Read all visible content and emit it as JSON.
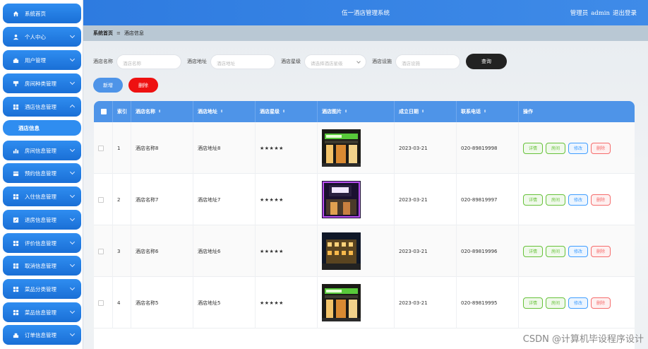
{
  "app": {
    "title": "伍一酒店管理系统",
    "user_role": "管理员",
    "user_name": "admin",
    "logout": "退出登录"
  },
  "breadcrumb": {
    "home": "系统首页",
    "sep": "≡",
    "current": "酒店信息"
  },
  "sidebar": {
    "items": [
      {
        "label": "系统首页",
        "icon": "home-icon",
        "expandable": false
      },
      {
        "label": "个人中心",
        "icon": "user-icon",
        "expandable": true
      },
      {
        "label": "用户管理",
        "icon": "users-icon",
        "expandable": true
      },
      {
        "label": "房间种类管理",
        "icon": "cup-icon",
        "expandable": true
      },
      {
        "label": "酒店信息管理",
        "icon": "grid-icon",
        "expandable": true,
        "expanded": true
      },
      {
        "label": "房间信息管理",
        "icon": "bar-chart-icon",
        "expandable": true
      },
      {
        "label": "预约信息管理",
        "icon": "calendar-icon",
        "expandable": true
      },
      {
        "label": "入住信息管理",
        "icon": "grid-icon",
        "expandable": true
      },
      {
        "label": "退房信息管理",
        "icon": "edit-icon",
        "expandable": true
      },
      {
        "label": "评价信息管理",
        "icon": "grid-icon",
        "expandable": true
      },
      {
        "label": "取消信息管理",
        "icon": "grid-icon",
        "expandable": true
      },
      {
        "label": "菜品分类管理",
        "icon": "grid-icon",
        "expandable": true
      },
      {
        "label": "菜品信息管理",
        "icon": "grid-icon",
        "expandable": true
      },
      {
        "label": "订单信息管理",
        "icon": "order-icon",
        "expandable": true
      }
    ],
    "sub_item": "酒店信息"
  },
  "search": {
    "name_label": "酒店名称",
    "name_placeholder": "酒店名称",
    "address_label": "酒店地址",
    "address_placeholder": "酒店地址",
    "star_label": "酒店星级",
    "star_placeholder": "请选择酒店星级",
    "facility_label": "酒店设施",
    "facility_placeholder": "酒店设施",
    "query_button": "查询"
  },
  "toolbar": {
    "add_button": "新增",
    "delete_button": "删除"
  },
  "table": {
    "columns": [
      "索引",
      "酒店名称",
      "酒店地址",
      "酒店星级",
      "酒店图片",
      "成立日期",
      "联系电话",
      "操作"
    ],
    "sort_glyph": "⇕",
    "rows": [
      {
        "index": "1",
        "name": "酒店名称8",
        "address": "酒店地址8",
        "stars": "★★★★★",
        "image": "hotel-facade-green-sign",
        "date": "2023-03-21",
        "phone": "020-89819998"
      },
      {
        "index": "2",
        "name": "酒店名称7",
        "address": "酒店地址7",
        "stars": "★★★★★",
        "image": "hotel-facade-purple-lights",
        "date": "2023-03-21",
        "phone": "020-89819997"
      },
      {
        "index": "3",
        "name": "酒店名称6",
        "address": "酒店地址6",
        "stars": "★★★★★",
        "image": "hotel-facade-night-gold",
        "date": "2023-03-21",
        "phone": "020-89819996"
      },
      {
        "index": "4",
        "name": "酒店名称5",
        "address": "酒店地址5",
        "stars": "★★★★★",
        "image": "hotel-facade-green-sign",
        "date": "2023-03-21",
        "phone": "020-89819995"
      }
    ],
    "row_actions": {
      "detail": "详情",
      "room": "房间",
      "edit": "修改",
      "delete": "删除"
    }
  },
  "watermark": "CSDN @计算机毕设程序设计",
  "colors": {
    "primary": "#2f8df0",
    "header": "#4e94e8",
    "danger": "#ee1111",
    "success": "#67c23a"
  }
}
